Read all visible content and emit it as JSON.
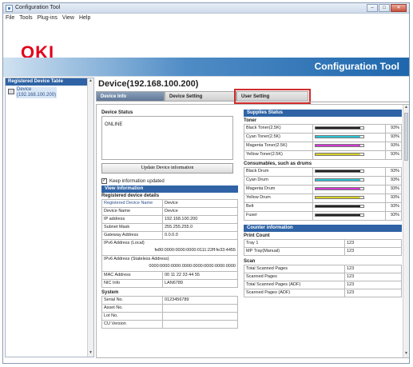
{
  "window": {
    "title": "Configuration Tool",
    "min": "–",
    "max": "□",
    "close": "✕"
  },
  "menu": [
    "File",
    "Tools",
    "Plug-ins",
    "View",
    "Help"
  ],
  "header": {
    "logo": "OKI",
    "app_title": "Configuration Tool"
  },
  "left_pane": {
    "title": "Registered Device Table",
    "device_label": "Device",
    "device_ip": "(192.168.100.200)"
  },
  "device_title": "Device(192.168.100.200)",
  "tabs": [
    "Device Info",
    "Device Setting",
    "User Setting"
  ],
  "device_status": {
    "label": "Device Status",
    "value": "ONLINE",
    "update_button": "Update Device information",
    "keep_label": "Keep information updated",
    "keep_checked": true
  },
  "view_info": {
    "title": "View Information",
    "registered_label": "Registered device details",
    "rows": [
      {
        "k": "Registered Device Name",
        "v": "Device"
      },
      {
        "k": "Device Name",
        "v": "Device"
      },
      {
        "k": "IP address",
        "v": "192.168.100.200"
      },
      {
        "k": "Subnet Mask",
        "v": "255.255.255.0"
      },
      {
        "k": "Gateway Address",
        "v": "0.0.0.0"
      }
    ],
    "ipv6_local_label": "IPv6 Address (Local)",
    "ipv6_local_value": "fe80:0000:0000:0000:0111:22ff:fe33:4455",
    "ipv6_stateless_label": "IPv6 Address (Stateless Address)",
    "ipv6_stateless_value": "0000:0000:0000:0000:0000:0000:0000:0000",
    "rows2": [
      {
        "k": "MAC Address",
        "v": "00 11 22 33 44 55"
      },
      {
        "k": "NIC Info",
        "v": "LAN6789"
      }
    ],
    "system_label": "System",
    "system_rows": [
      {
        "k": "Serial No.",
        "v": "0123456789"
      },
      {
        "k": "Asset No.",
        "v": ""
      },
      {
        "k": "Lot No.",
        "v": ""
      },
      {
        "k": "CU Version",
        "v": ""
      }
    ]
  },
  "supplies": {
    "title": "Supplies Status",
    "toner_label": "Toner",
    "toner": [
      {
        "name": "Black Toner(2.5K)",
        "pct": "93%",
        "level": 0.93,
        "color": "#222222"
      },
      {
        "name": "Cyan Toner(2.5K)",
        "pct": "93%",
        "level": 0.93,
        "color": "#2ec4d6"
      },
      {
        "name": "Magenta Toner(2.5K)",
        "pct": "93%",
        "level": 0.93,
        "color": "#d13ad4"
      },
      {
        "name": "Yellow Toner(2.5K)",
        "pct": "93%",
        "level": 0.93,
        "color": "#d7d12c"
      }
    ],
    "consumables_label": "Consumables, such as drums",
    "consumables": [
      {
        "name": "Black Drum",
        "pct": "93%",
        "level": 0.93,
        "color": "#222222"
      },
      {
        "name": "Cyan Drum",
        "pct": "93%",
        "level": 0.93,
        "color": "#2ec4d6"
      },
      {
        "name": "Magenta Drum",
        "pct": "93%",
        "level": 0.93,
        "color": "#d13ad4"
      },
      {
        "name": "Yellow Drum",
        "pct": "93%",
        "level": 0.93,
        "color": "#d7d12c"
      },
      {
        "name": "Belt",
        "pct": "93%",
        "level": 0.93,
        "color": "#222222"
      },
      {
        "name": "Fuser",
        "pct": "93%",
        "level": 0.93,
        "color": "#222222"
      }
    ]
  },
  "counter": {
    "title": "Counter information",
    "print_label": "Print Count",
    "print_rows": [
      {
        "k": "Tray 1",
        "v": "123"
      },
      {
        "k": "MP Tray(Manual)",
        "v": "123"
      }
    ],
    "scan_label": "Scan",
    "scan_rows": [
      {
        "k": "Total Scanned Pages",
        "v": "123"
      },
      {
        "k": "Scanned Pages",
        "v": "123"
      },
      {
        "k": "Total Scanned Pages (ADF)",
        "v": "123"
      },
      {
        "k": "Scanned Pages (ADF)",
        "v": "123"
      }
    ]
  }
}
